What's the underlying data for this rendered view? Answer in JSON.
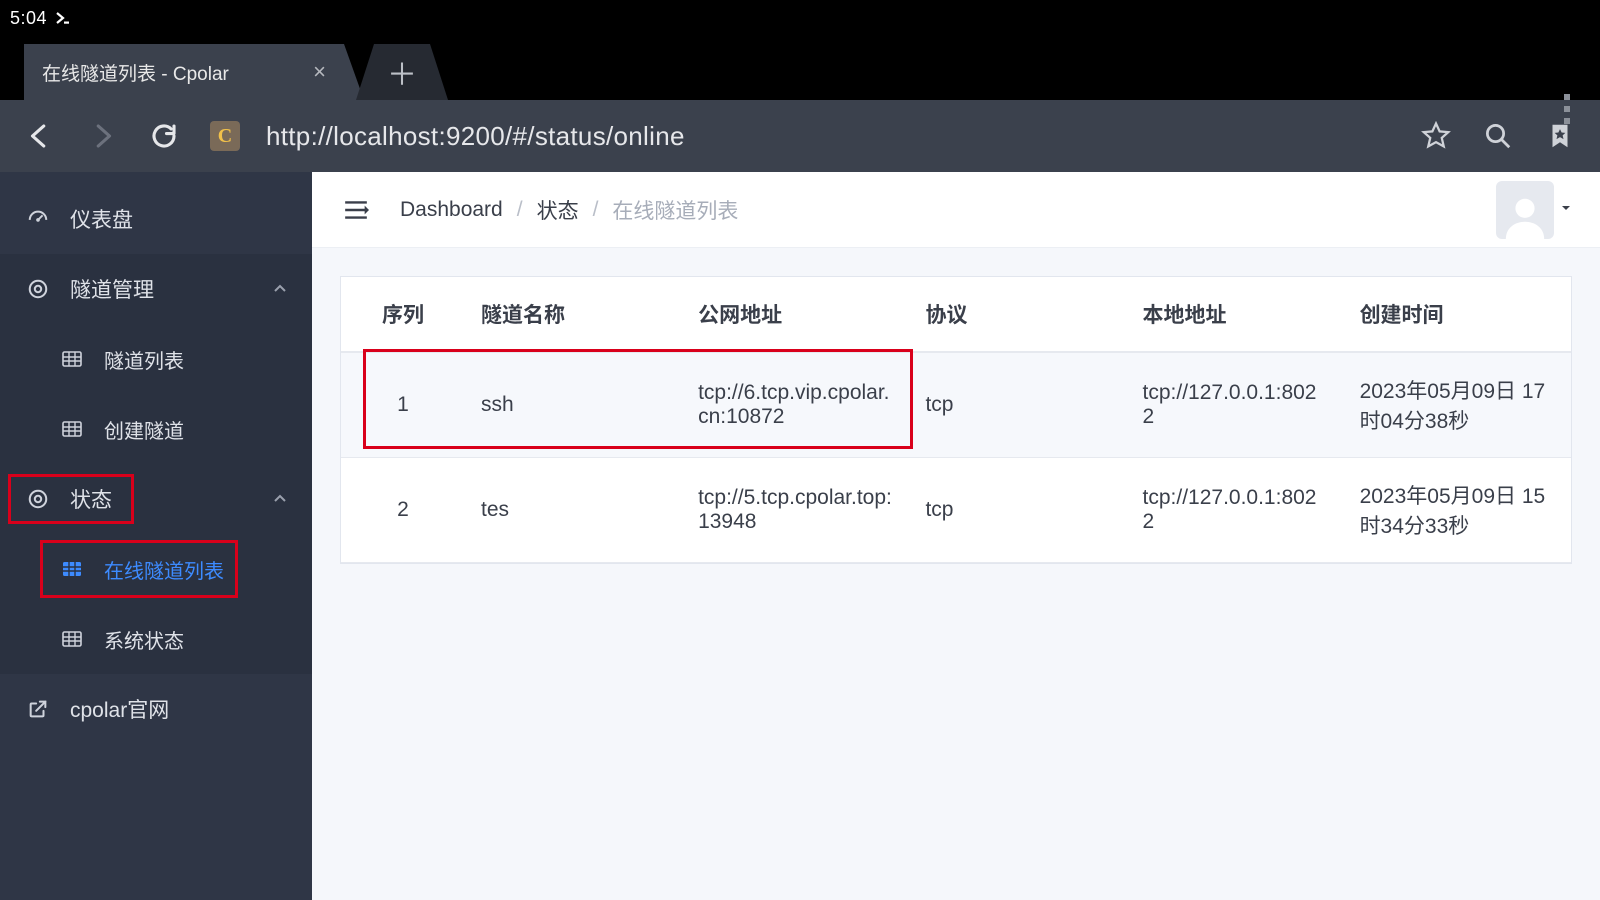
{
  "os": {
    "time": "5:04"
  },
  "browser": {
    "tab_title": "在线隧道列表 - Cpolar",
    "favicon_letter": "C",
    "url": "http://localhost:9200/#/status/online"
  },
  "sidebar": {
    "items": {
      "dashboard": "仪表盘",
      "tunnel_mgmt": "隧道管理",
      "tunnel_list": "隧道列表",
      "create_tunnel": "创建隧道",
      "status": "状态",
      "online_tunnel_list": "在线隧道列表",
      "system_status": "系统状态",
      "cpolar_site": "cpolar官网"
    }
  },
  "breadcrumb": {
    "a": "Dashboard",
    "b": "状态",
    "c": "在线隧道列表"
  },
  "table": {
    "headers": {
      "seq": "序列",
      "name": "隧道名称",
      "public": "公网地址",
      "proto": "协议",
      "local": "本地地址",
      "created": "创建时间"
    },
    "rows": [
      {
        "seq": "1",
        "name": "ssh",
        "public": "tcp://6.tcp.vip.cpolar.cn:10872",
        "proto": "tcp",
        "local": "tcp://127.0.0.1:8022",
        "created": "2023年05月09日 17时04分38秒"
      },
      {
        "seq": "2",
        "name": "tes",
        "public": "tcp://5.tcp.cpolar.top:13948",
        "proto": "tcp",
        "local": "tcp://127.0.0.1:8022",
        "created": "2023年05月09日 15时34分33秒"
      }
    ]
  }
}
